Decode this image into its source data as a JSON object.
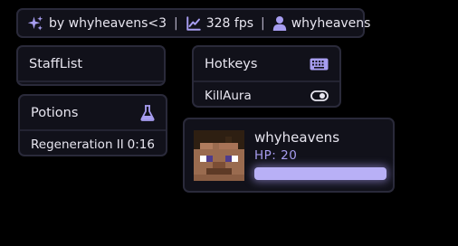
{
  "watermark": {
    "credit": "by whyheavens<3",
    "separator": "|",
    "fps": "328 fps",
    "username": "whyheavens",
    "icons": [
      "sparkles-icon",
      "chart-line-icon",
      "user-icon"
    ]
  },
  "stafflist": {
    "title": "StaffList"
  },
  "hotkeys": {
    "title": "Hotkeys",
    "icon": "keyboard-icon",
    "items": [
      {
        "label": "KillAura",
        "icon": "toggle-icon",
        "enabled": true
      }
    ]
  },
  "potions": {
    "title": "Potions",
    "icon": "flask-icon",
    "items": [
      {
        "name": "Regeneration II",
        "time": "0:16"
      }
    ]
  },
  "targethud": {
    "name": "whyheavens",
    "hp_label": "HP: 20",
    "health_fraction": 1.0,
    "avatar": "player-head-icon"
  },
  "colors": {
    "accent": "#a79df0",
    "hp_bar": "#b8b0f6",
    "background": "#000000",
    "panel": "#11111a"
  }
}
